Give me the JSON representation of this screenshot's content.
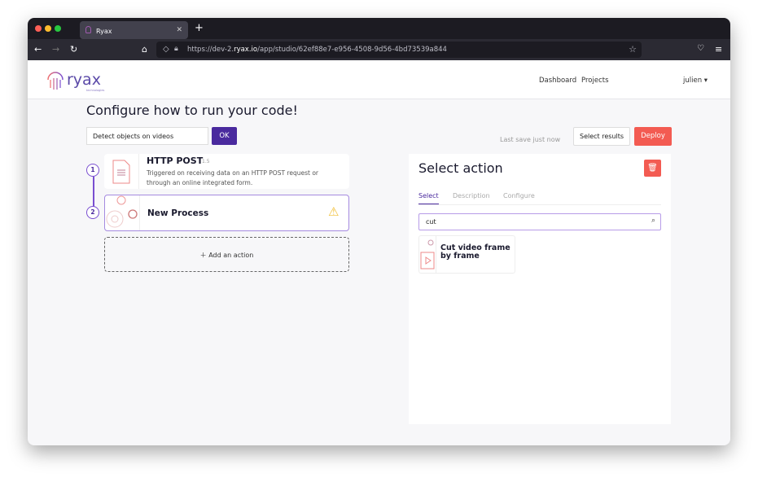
{
  "browser": {
    "tab_title": "Ryax",
    "url_prefix": "https://dev-2.",
    "url_domain": "ryax.io",
    "url_path": "/app/studio/62ef88e7-e956-4508-9d56-4bd73539a844"
  },
  "header": {
    "logo_text": "ryax",
    "logo_sub": "technologies",
    "nav": [
      "Dashboard",
      "Projects"
    ],
    "user": "julien"
  },
  "page": {
    "title": "Configure how to run your code!",
    "workflow_name": "Detect objects on videos",
    "ok_label": "OK",
    "last_save": "Last save just now",
    "select_results_label": "Select results",
    "deploy_label": "Deploy"
  },
  "steps": [
    {
      "number": "1",
      "name": "HTTP POST",
      "version": "1.5",
      "description": "Triggered on receiving data on an HTTP POST request or through an online integrated form."
    },
    {
      "number": "2",
      "name": "New Process",
      "status": "warning"
    }
  ],
  "add_action_label": "Add an action",
  "panel": {
    "title": "Select action",
    "tabs": [
      "Select",
      "Description",
      "Configure"
    ],
    "active_tab": "Select",
    "search_value": "cut",
    "results": [
      {
        "name": "Cut video frame by frame"
      }
    ]
  },
  "colors": {
    "accent": "#4a2a9e",
    "danger": "#f35b52",
    "warning": "#f2c037"
  }
}
